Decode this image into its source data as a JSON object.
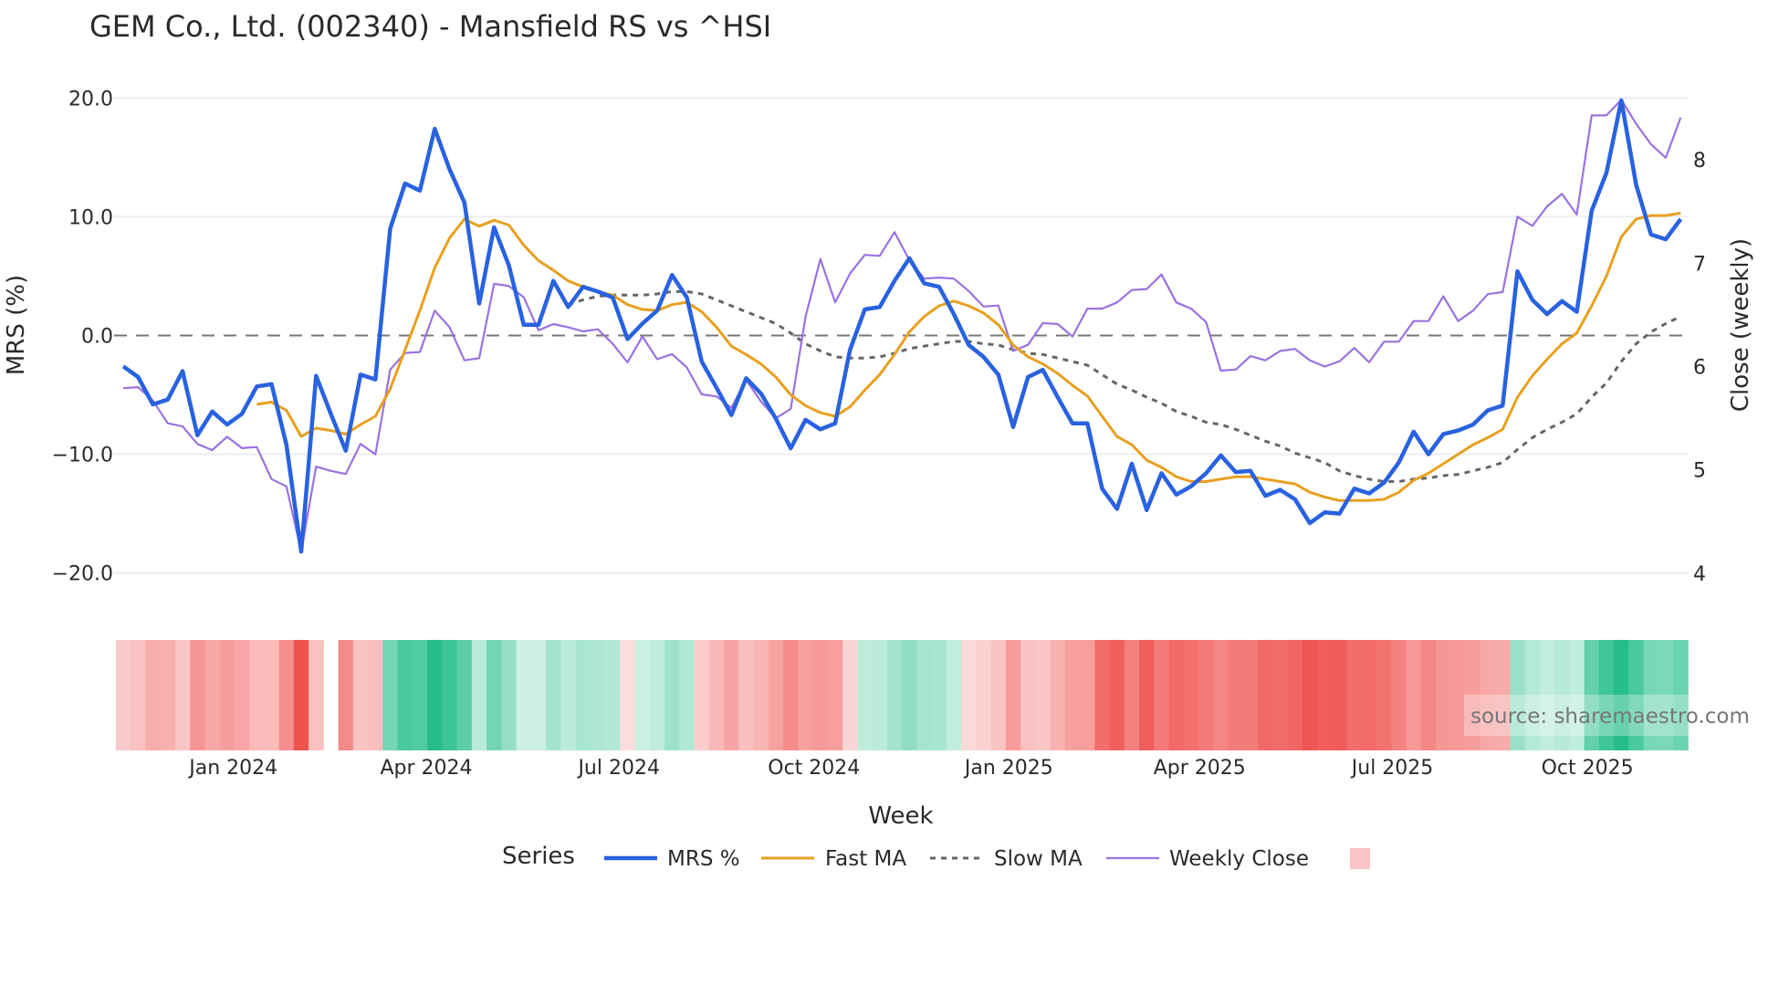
{
  "chart_data": {
    "type": "line",
    "title": "GEM Co., Ltd. (002340) - Mansfield RS vs ^HSI",
    "xlabel": "Week",
    "ylabel": "MRS (%)",
    "y2label": "Close (weekly)",
    "ylim": [
      -22.1,
      22.1
    ],
    "y2lim": [
      3.76,
      8.84
    ],
    "y_ticks": [
      {
        "value": 20,
        "label": "20.0"
      },
      {
        "value": 10,
        "label": "10.0"
      },
      {
        "value": 0,
        "label": "0.0"
      },
      {
        "value": -10,
        "label": "−10.0"
      },
      {
        "value": -20,
        "label": "−20.0"
      }
    ],
    "y2_ticks": [
      {
        "value": 8,
        "label": "8"
      },
      {
        "value": 7,
        "label": "7"
      },
      {
        "value": 6,
        "label": "6"
      },
      {
        "value": 5,
        "label": "5"
      },
      {
        "value": 4,
        "label": "4"
      }
    ],
    "x_start": "2023-11-10",
    "x_step_days": 7,
    "x_end": "2025-11-21",
    "x_ticks": [
      {
        "date": "2024-01-01",
        "label": "Jan 2024"
      },
      {
        "date": "2024-04-01",
        "label": "Apr 2024"
      },
      {
        "date": "2024-07-01",
        "label": "Jul 2024"
      },
      {
        "date": "2024-10-01",
        "label": "Oct 2024"
      },
      {
        "date": "2025-01-01",
        "label": "Jan 2025"
      },
      {
        "date": "2025-04-01",
        "label": "Apr 2025"
      },
      {
        "date": "2025-07-01",
        "label": "Jul 2025"
      },
      {
        "date": "2025-10-01",
        "label": "Oct 2025"
      }
    ],
    "zero_line": 0,
    "grid": true,
    "legend_title": "Series",
    "legend_placement": "bottom",
    "series": [
      {
        "name": "MRS %",
        "axis": "y",
        "color": "#2962e0",
        "style": "solid",
        "values": [
          -2.6,
          -3.5,
          -5.8,
          -5.4,
          -3.0,
          -8.4,
          -6.4,
          -7.5,
          -6.6,
          -4.3,
          -4.1,
          -9.2,
          -18.2,
          -3.4,
          -6.6,
          -9.7,
          -3.3,
          -3.7,
          9.0,
          12.8,
          12.2,
          17.4,
          14.0,
          11.2,
          2.7,
          9.1,
          5.9,
          0.9,
          0.9,
          4.6,
          2.4,
          4.1,
          3.7,
          3.2,
          -0.3,
          1.0,
          2.1,
          5.1,
          3.2,
          -2.2,
          -4.4,
          -6.7,
          -3.6,
          -4.9,
          -7.0,
          -9.5,
          -7.1,
          -7.9,
          -7.4,
          -1.2,
          2.2,
          2.4,
          4.6,
          6.5,
          4.4,
          4.1,
          1.8,
          -0.8,
          -1.8,
          -3.3,
          -7.7,
          -3.5,
          -2.9,
          -5.2,
          -7.4,
          -7.4,
          -12.9,
          -14.6,
          -10.8,
          -14.7,
          -11.6,
          -13.4,
          -12.7,
          -11.6,
          -10.1,
          -11.5,
          -11.4,
          -13.5,
          -13.0,
          -13.8,
          -15.8,
          -14.9,
          -15.0,
          -12.9,
          -13.3,
          -12.4,
          -10.7,
          -8.1,
          -10.0,
          -8.3,
          -8.0,
          -7.5,
          -6.3,
          -5.9,
          5.4,
          3.0,
          1.8,
          2.9,
          2.0,
          10.5,
          13.7,
          19.8,
          12.7,
          8.5,
          8.1,
          9.8
        ]
      },
      {
        "name": "Fast MA",
        "axis": "y",
        "color": "#e8a020",
        "style": "solid",
        "values": [
          null,
          null,
          null,
          null,
          null,
          null,
          null,
          null,
          null,
          -5.8,
          -5.6,
          -6.3,
          -8.5,
          -7.8,
          -8.0,
          -8.3,
          -7.5,
          -6.8,
          -4.5,
          -1.2,
          2.1,
          5.7,
          8.2,
          9.8,
          9.2,
          9.7,
          9.3,
          7.6,
          6.3,
          5.5,
          4.6,
          4.1,
          3.7,
          3.4,
          2.6,
          2.2,
          2.1,
          2.6,
          2.8,
          2.0,
          0.7,
          -0.9,
          -1.6,
          -2.4,
          -3.5,
          -5.0,
          -5.9,
          -6.5,
          -6.8,
          -6.0,
          -4.6,
          -3.3,
          -1.6,
          0.3,
          1.6,
          2.5,
          2.9,
          2.5,
          1.9,
          0.9,
          -0.8,
          -1.8,
          -2.4,
          -3.2,
          -4.2,
          -5.1,
          -6.8,
          -8.5,
          -9.2,
          -10.5,
          -11.1,
          -11.9,
          -12.3,
          -12.3,
          -12.1,
          -11.9,
          -11.9,
          -12.1,
          -12.3,
          -12.5,
          -13.2,
          -13.6,
          -13.9,
          -13.9,
          -13.9,
          -13.8,
          -13.2,
          -12.2,
          -11.6,
          -10.8,
          -10.0,
          -9.2,
          -8.6,
          -7.9,
          -5.2,
          -3.4,
          -2.0,
          -0.7,
          0.2,
          2.5,
          5.0,
          8.3,
          9.8,
          10.1,
          10.1,
          10.3
        ]
      },
      {
        "name": "Slow MA",
        "axis": "y",
        "color": "#666666",
        "style": "dotted",
        "values": [
          null,
          null,
          null,
          null,
          null,
          null,
          null,
          null,
          null,
          null,
          null,
          null,
          null,
          null,
          null,
          null,
          null,
          null,
          null,
          null,
          null,
          null,
          null,
          null,
          null,
          null,
          null,
          null,
          null,
          null,
          2.6,
          3.0,
          3.3,
          3.4,
          3.4,
          3.4,
          3.5,
          3.7,
          3.7,
          3.5,
          3.0,
          2.5,
          2.0,
          1.5,
          1.0,
          0.2,
          -0.7,
          -1.3,
          -1.8,
          -1.9,
          -1.9,
          -1.8,
          -1.5,
          -1.1,
          -0.9,
          -0.7,
          -0.5,
          -0.5,
          -0.7,
          -0.8,
          -1.2,
          -1.5,
          -1.6,
          -1.9,
          -2.2,
          -2.5,
          -3.3,
          -4.1,
          -4.6,
          -5.2,
          -5.7,
          -6.4,
          -6.8,
          -7.3,
          -7.5,
          -7.9,
          -8.4,
          -8.9,
          -9.3,
          -9.9,
          -10.3,
          -10.7,
          -11.4,
          -11.8,
          -12.1,
          -12.3,
          -12.3,
          -12.1,
          -12.0,
          -11.8,
          -11.7,
          -11.4,
          -11.1,
          -10.7,
          -9.6,
          -8.6,
          -7.9,
          -7.3,
          -6.6,
          -5.2,
          -4.0,
          -2.2,
          -0.7,
          0.3,
          1.0,
          1.6
        ]
      },
      {
        "name": "Weekly Close",
        "axis": "y2",
        "color": "#9b72e0",
        "style": "solid",
        "values": [
          5.79,
          5.8,
          5.67,
          5.45,
          5.42,
          5.25,
          5.19,
          5.32,
          5.21,
          5.22,
          4.91,
          4.84,
          4.21,
          5.03,
          4.99,
          4.96,
          5.25,
          5.15,
          5.97,
          6.13,
          6.14,
          6.54,
          6.38,
          6.06,
          6.08,
          6.8,
          6.78,
          6.67,
          6.35,
          6.41,
          6.38,
          6.34,
          6.36,
          6.22,
          6.04,
          6.29,
          6.07,
          6.12,
          5.99,
          5.73,
          5.71,
          5.6,
          5.87,
          5.66,
          5.5,
          5.59,
          6.48,
          7.04,
          6.62,
          6.9,
          7.08,
          7.07,
          7.3,
          7.03,
          6.85,
          6.86,
          6.85,
          6.73,
          6.58,
          6.59,
          6.15,
          6.21,
          6.42,
          6.41,
          6.29,
          6.56,
          6.56,
          6.62,
          6.74,
          6.75,
          6.89,
          6.62,
          6.56,
          6.43,
          5.96,
          5.97,
          6.1,
          6.06,
          6.15,
          6.17,
          6.06,
          6.0,
          6.05,
          6.18,
          6.04,
          6.24,
          6.24,
          6.44,
          6.44,
          6.68,
          6.44,
          6.54,
          6.7,
          6.72,
          7.45,
          7.36,
          7.55,
          7.67,
          7.47,
          8.43,
          8.43,
          8.58,
          8.35,
          8.15,
          8.02,
          8.41
        ]
      }
    ],
    "heatmap": {
      "source_series": "MRS %",
      "missing_index": [
        14
      ],
      "neg_color": "#ef5350",
      "pos_color": "#26be8c"
    },
    "legend_swatch_color": "#f8c4c4"
  },
  "watermark": "source: sharemaestro.com"
}
